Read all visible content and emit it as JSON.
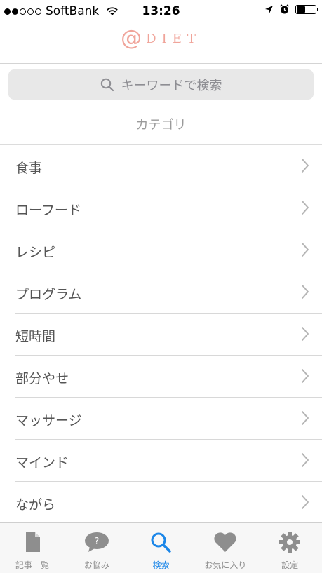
{
  "status_bar": {
    "carrier": "SoftBank",
    "time": "13:26",
    "signal_filled": 2,
    "signal_total": 5,
    "battery_level": 0.45
  },
  "header": {
    "logo_symbol": "@",
    "logo_text": "DIET",
    "logo_color": "#f0a49a"
  },
  "search": {
    "placeholder": "キーワードで検索",
    "icon": "search-icon"
  },
  "category": {
    "heading": "カテゴリ",
    "items": [
      {
        "label": "食事"
      },
      {
        "label": "ローフード"
      },
      {
        "label": "レシピ"
      },
      {
        "label": "プログラム"
      },
      {
        "label": "短時間"
      },
      {
        "label": "部分やせ"
      },
      {
        "label": "マッサージ"
      },
      {
        "label": "マインド"
      },
      {
        "label": "ながら"
      }
    ]
  },
  "tab_bar": {
    "active_color": "#1b86e8",
    "inactive_color": "#8e8e8e",
    "tabs": [
      {
        "label": "記事一覧",
        "icon": "document-icon",
        "active": false
      },
      {
        "label": "お悩み",
        "icon": "question-bubble-icon",
        "active": false
      },
      {
        "label": "検索",
        "icon": "search-icon",
        "active": true
      },
      {
        "label": "お気に入り",
        "icon": "heart-icon",
        "active": false
      },
      {
        "label": "設定",
        "icon": "gear-icon",
        "active": false
      }
    ]
  }
}
